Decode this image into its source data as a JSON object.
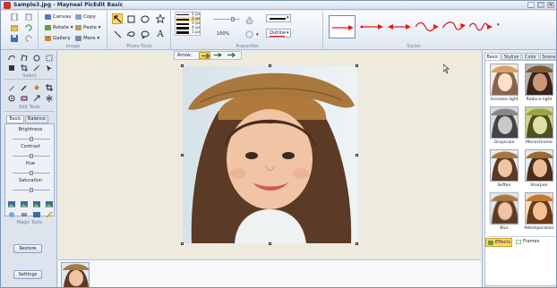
{
  "window": {
    "title": "Sample3.jpg - Mayneal PicEdit Basic",
    "minimize": "_",
    "maximize": "□",
    "close": "×"
  },
  "ribbon": {
    "image": {
      "label": "Image",
      "buttons": [
        "Canvas",
        "Rotate",
        "Gallery",
        "Copy",
        "Paste",
        "More"
      ]
    },
    "tools": {
      "label": "Photo Tools"
    },
    "properties": {
      "label": "Properties",
      "sizes": [
        "1 px",
        "2 px",
        "3 px",
        "4 px",
        "5 px"
      ],
      "selected_size": "2 px",
      "zoom": "100%",
      "outline": "Outline"
    },
    "styles": {
      "label": "Styles"
    }
  },
  "left": {
    "select_label": "Select",
    "edit_label": "Edit Tools",
    "tabs": [
      "Basic",
      "Balance"
    ],
    "active_tab": "Basic",
    "adjust": [
      {
        "label": "Brightness",
        "value": 0.5
      },
      {
        "label": "Contrast",
        "value": 0.5
      },
      {
        "label": "Hue",
        "value": 0.5
      },
      {
        "label": "Saturation",
        "value": 0.5
      }
    ],
    "magic_label": "Magic Tools",
    "restore": "Restore",
    "settings": "Settings"
  },
  "canvas": {
    "arrow_label": "Arrow:"
  },
  "right": {
    "tabs": [
      "Basic",
      "Stylize",
      "Color",
      "Scene"
    ],
    "active_tab": "Basic",
    "effects": [
      "Increase light",
      "Reduce light",
      "Grayscale",
      "Monochrome",
      "Soften",
      "Sharpen",
      "Blur",
      "Attemperation"
    ],
    "bottom_tabs": [
      "Effects",
      "Frames"
    ],
    "active_bottom": "Effects"
  },
  "colors": {
    "accent": "#ffd86b",
    "arrow_red": "#e21818"
  }
}
